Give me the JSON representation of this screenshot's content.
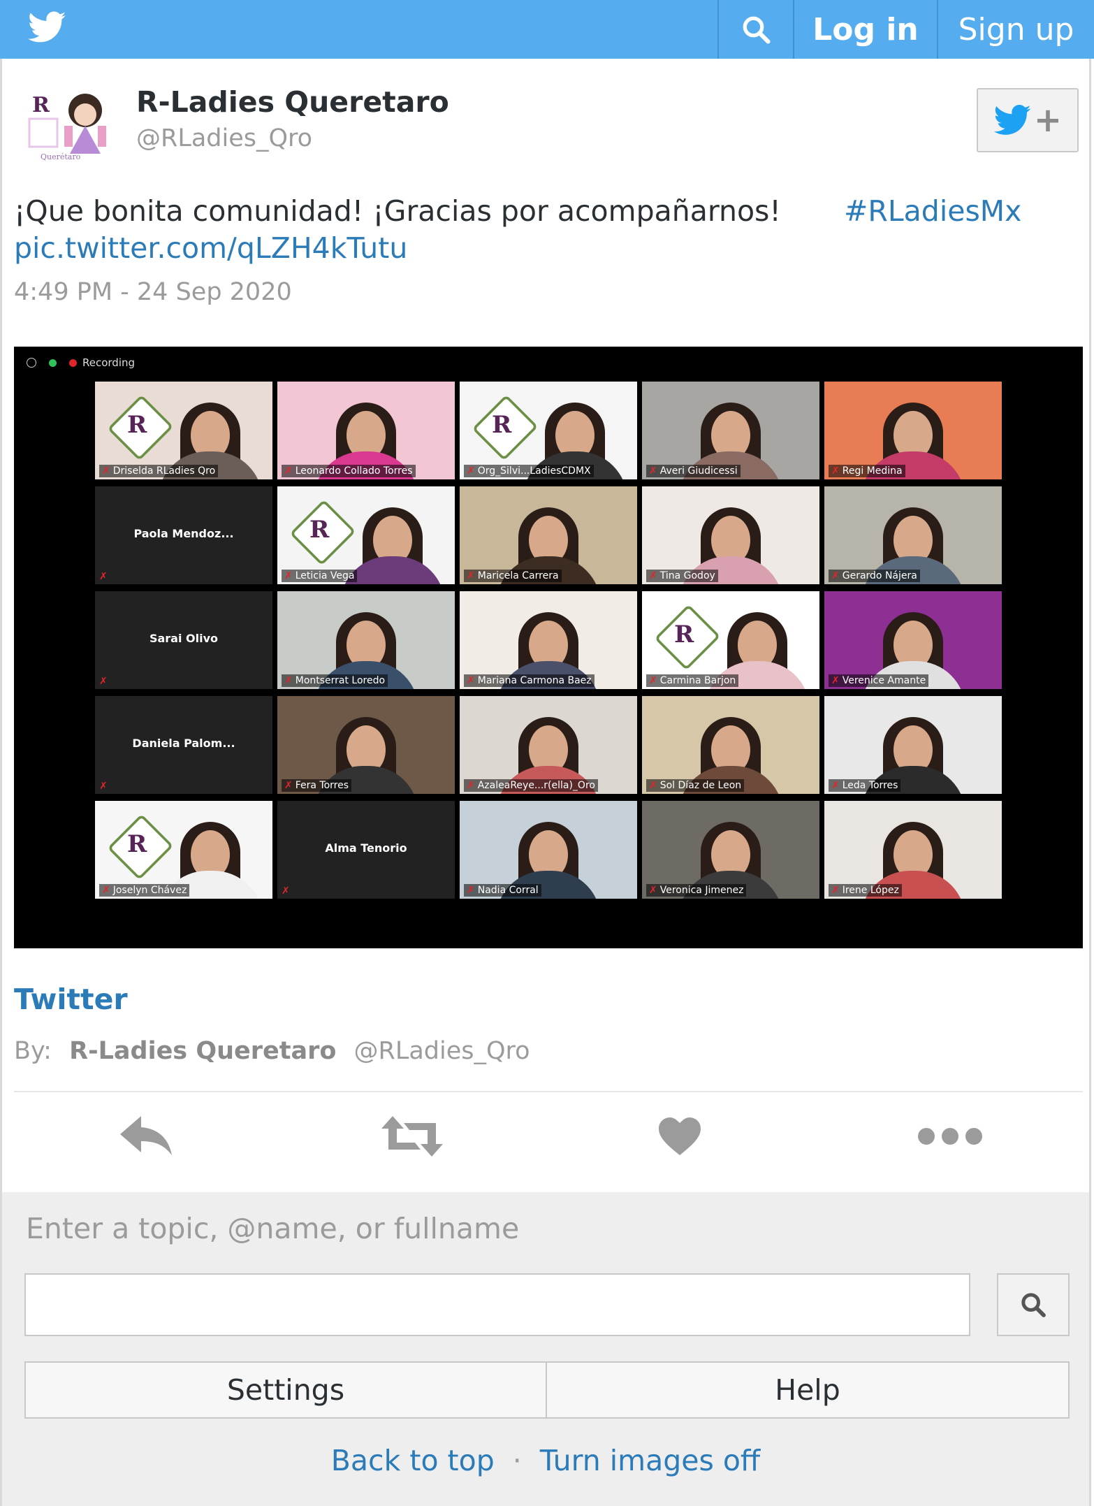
{
  "colors": {
    "topbar": "#55acee",
    "link": "#2b7bb9",
    "muted": "#9b9b9b",
    "footer_bg": "#eeeeee"
  },
  "nav": {
    "logo_icon": "twitter-bird-icon",
    "search_icon": "search-icon",
    "login_label": "Log in",
    "signup_label": "Sign up"
  },
  "tweet": {
    "display_name": "R-Ladies Queretaro",
    "handle": "@RLadies_Qro",
    "text": "¡Que bonita comunidad! ¡Gracias por acompañarnos!",
    "hashtag": "#RLadiesMx",
    "pic_link": "pic.twitter.com/qLZH4kTutu",
    "timestamp": "4:49 PM - 24 Sep 2020",
    "follow_icon": "twitter-follow-icon",
    "follow_plus": "+"
  },
  "media": {
    "recording_label": "Recording",
    "participants": [
      {
        "name": "Driselda RLadies Qro",
        "video": true,
        "logo": true
      },
      {
        "name": "Leonardo Collado Torres",
        "video": true
      },
      {
        "name": "Org_Silvi...LadiesCDMX",
        "video": true,
        "logo": true
      },
      {
        "name": "Averi Giudicessi",
        "video": true
      },
      {
        "name": "Regi Medina",
        "video": true
      },
      {
        "name": "Paola Mendoz...",
        "video": false
      },
      {
        "name": "Leticia Vega",
        "video": true,
        "logo": true
      },
      {
        "name": "Maricela Carrera",
        "video": true
      },
      {
        "name": "Tina Godoy",
        "video": true
      },
      {
        "name": "Gerardo Nájera",
        "video": true
      },
      {
        "name": "Sarai Olivo",
        "video": false
      },
      {
        "name": "Montserrat Loredo",
        "video": true
      },
      {
        "name": "Mariana Carmona Baez",
        "video": true
      },
      {
        "name": "Carmina Barjon",
        "video": true,
        "logo": true
      },
      {
        "name": "Verenice Amante",
        "video": true
      },
      {
        "name": "Daniela Palom...",
        "video": false
      },
      {
        "name": "Fera Torres",
        "video": true
      },
      {
        "name": "AzaleaReye...r(ella)_Oro",
        "video": true
      },
      {
        "name": "Sol Díaz de Leon",
        "video": true
      },
      {
        "name": "Leda Torres",
        "video": true
      },
      {
        "name": "Joselyn Chávez",
        "video": true,
        "logo": true
      },
      {
        "name": "Alma Tenorio",
        "video": false
      },
      {
        "name": "Nadia Corral",
        "video": true
      },
      {
        "name": "Veronica Jimenez",
        "video": true,
        "active": true
      },
      {
        "name": "Irene López",
        "video": true
      }
    ]
  },
  "card": {
    "title": "Twitter",
    "by_label": "By:",
    "author": "R-Ladies Queretaro",
    "author_handle": "@RLadies_Qro"
  },
  "actions": {
    "reply_icon": "reply-icon",
    "retweet_icon": "retweet-icon",
    "like_icon": "heart-icon",
    "more_icon": "more-dots-icon"
  },
  "footer": {
    "search_label": "Enter a topic, @name, or fullname",
    "search_value": "",
    "settings_label": "Settings",
    "help_label": "Help",
    "back_to_top": "Back to top",
    "separator": "·",
    "images_off": "Turn images off"
  }
}
